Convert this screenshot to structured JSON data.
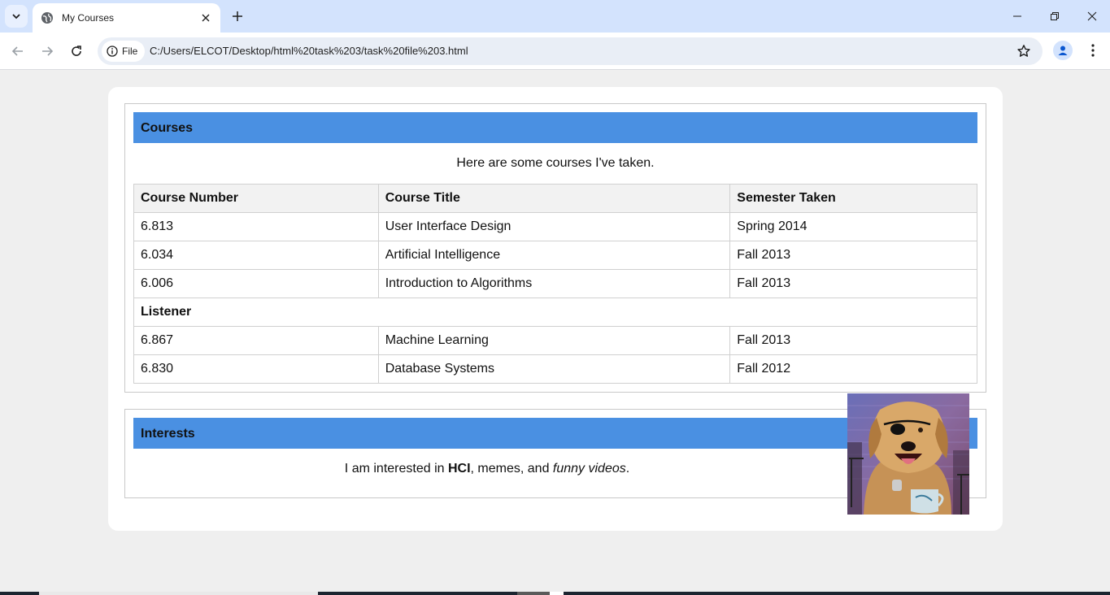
{
  "browser": {
    "tab_title": "My Courses",
    "address_chip": "File",
    "url": "C:/Users/ELCOT/Desktop/html%20task%203/task%20file%203.html"
  },
  "courses": {
    "header": "Courses",
    "intro": "Here are some courses I've taken.",
    "columns": [
      "Course Number",
      "Course Title",
      "Semester Taken"
    ],
    "rows": [
      [
        "6.813",
        "User Interface Design",
        "Spring 2014"
      ],
      [
        "6.034",
        "Artificial Intelligence",
        "Fall 2013"
      ],
      [
        "6.006",
        "Introduction to Algorithms",
        "Fall 2013"
      ]
    ],
    "group_label": "Listener",
    "listener_rows": [
      [
        "6.867",
        "Machine Learning",
        "Fall 2013"
      ],
      [
        "6.830",
        "Database Systems",
        "Fall 2012"
      ]
    ]
  },
  "interests": {
    "header": "Interests",
    "prefix": "I am interested in ",
    "bold": "HCI",
    "middle": ", memes, and ",
    "italic": "funny videos",
    "suffix": "."
  },
  "colors": {
    "section_header": "#4a90e2",
    "page_background": "#efefef",
    "tabstrip": "#d3e3fd"
  }
}
